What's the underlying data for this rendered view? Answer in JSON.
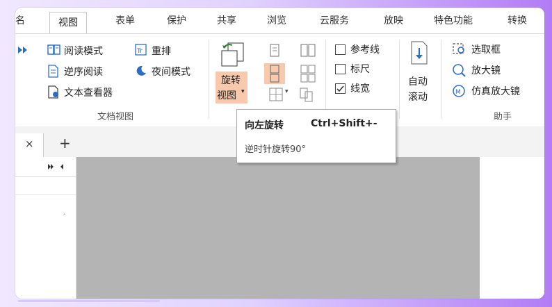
{
  "tabs": [
    {
      "label": "名",
      "active": false
    },
    {
      "label": "视图",
      "active": true
    },
    {
      "label": "表单",
      "active": false
    },
    {
      "label": "保护",
      "active": false
    },
    {
      "label": "共享",
      "active": false
    },
    {
      "label": "浏览",
      "active": false
    },
    {
      "label": "云服务",
      "active": false
    },
    {
      "label": "放映",
      "active": false
    },
    {
      "label": "特色功能",
      "active": false
    },
    {
      "label": "转换",
      "active": false
    }
  ],
  "ribbon": {
    "doc_view": {
      "read_mode": "阅读模式",
      "reflow": "重排",
      "reverse_read": "逆序阅读",
      "night_mode": "夜间模式",
      "text_viewer": "文本查看器",
      "group_label": "文档视图"
    },
    "rotate": {
      "line1": "旋转",
      "line2": "视图"
    },
    "checks": [
      {
        "label": "参考线",
        "checked": false
      },
      {
        "label": "标尺",
        "checked": false
      },
      {
        "label": "线宽",
        "checked": true
      }
    ],
    "auto_scroll": {
      "line1": "自动",
      "line2": "滚动"
    },
    "assistant": {
      "select_box": "选取框",
      "magnifier": "放大镜",
      "true_magnifier": "仿真放大镜",
      "group_label": "助手"
    }
  },
  "tooltip": {
    "title": "向左旋转",
    "shortcut": "Ctrl+Shift+-",
    "desc": "逆时针旋转90°"
  },
  "doc_tabs": {
    "close": "×",
    "add": "+"
  },
  "colors": {
    "accent": "#2b6cc4",
    "highlight": "#f9c9ad",
    "page_gray": "#b4b4b4"
  }
}
